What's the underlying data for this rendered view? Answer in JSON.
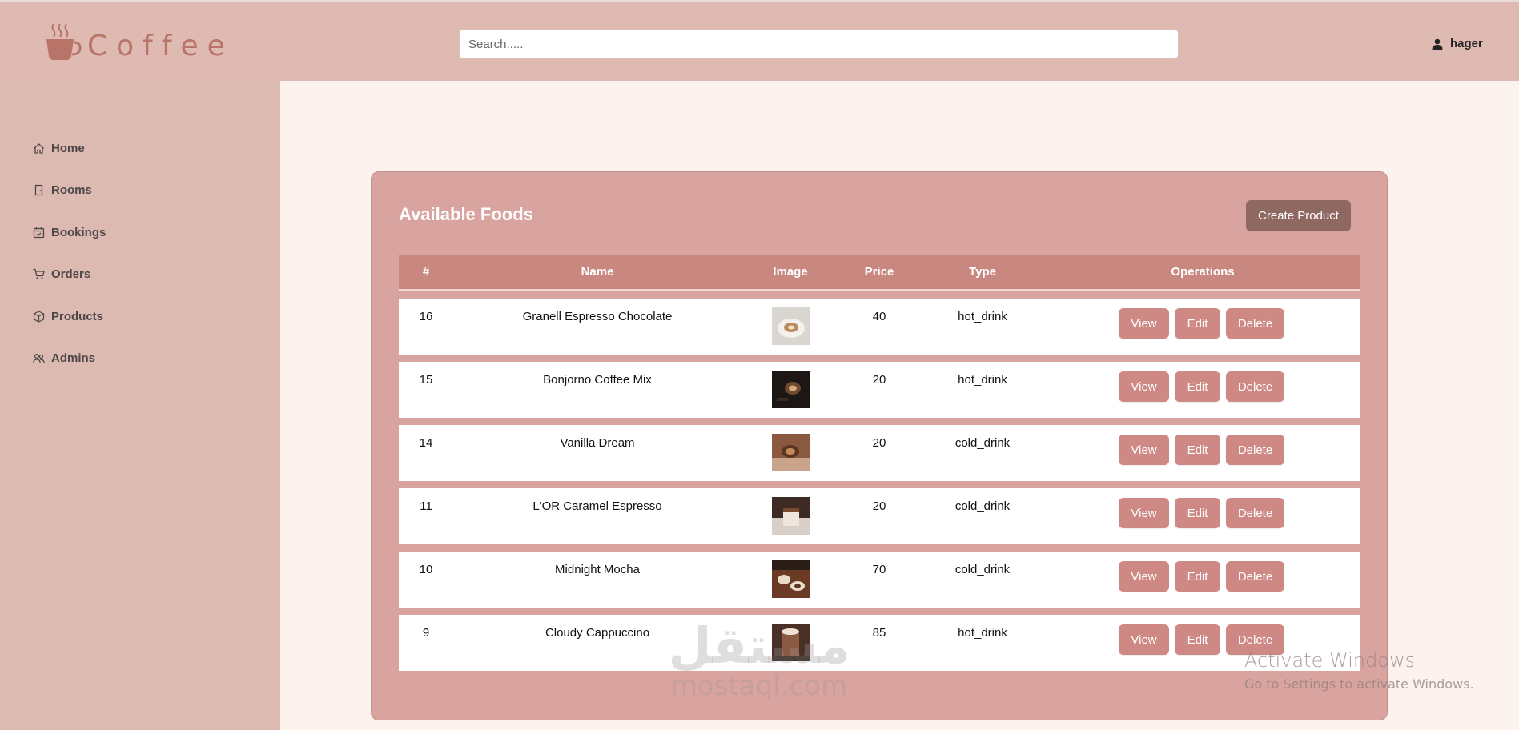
{
  "brand": {
    "name": "Coffee",
    "icon": "coffee-cup-icon",
    "color": "#b87468"
  },
  "search": {
    "placeholder": "Search....."
  },
  "user": {
    "name": "hager",
    "icon": "user-icon"
  },
  "sidebar": {
    "items": [
      {
        "label": "Home",
        "icon": "home-icon"
      },
      {
        "label": "Rooms",
        "icon": "door-icon"
      },
      {
        "label": "Bookings",
        "icon": "calendar-check-icon"
      },
      {
        "label": "Orders",
        "icon": "cart-icon"
      },
      {
        "label": "Products",
        "icon": "box-icon"
      },
      {
        "label": "Admins",
        "icon": "users-icon"
      }
    ]
  },
  "panel": {
    "title": "Available Foods",
    "create_label": "Create Product",
    "columns": [
      "#",
      "Name",
      "Image",
      "Price",
      "Type",
      "Operations"
    ],
    "action_labels": {
      "view": "View",
      "edit": "Edit",
      "delete": "Delete"
    },
    "rows": [
      {
        "id": "16",
        "name": "Granell Espresso Chocolate",
        "price": "40",
        "type": "hot_drink",
        "image": "latte-art-cup-photo"
      },
      {
        "id": "15",
        "name": "Bonjorno Coffee Mix",
        "price": "20",
        "type": "hot_drink",
        "image": "espresso-dark-photo"
      },
      {
        "id": "14",
        "name": "Vanilla Dream",
        "price": "20",
        "type": "cold_drink",
        "image": "coffee-wood-photo"
      },
      {
        "id": "11",
        "name": "L'OR Caramel Espresso",
        "price": "20",
        "type": "cold_drink",
        "image": "caramel-dessert-photo"
      },
      {
        "id": "10",
        "name": "Midnight Mocha",
        "price": "70",
        "type": "cold_drink",
        "image": "mocha-table-photo"
      },
      {
        "id": "9",
        "name": "Cloudy Cappuccino",
        "price": "85",
        "type": "hot_drink",
        "image": "cappuccino-photo"
      }
    ]
  },
  "overlay": {
    "watermark_ar": "مستقل",
    "watermark_en": "mostaql.com",
    "activate_title": "Activate Windows",
    "activate_sub": "Go to Settings to activate Windows."
  },
  "colors": {
    "topbar": "#dfbab2",
    "sidebar": "#dcb9b1",
    "content": "#fdf3ee",
    "panel": "#d9a49f",
    "table_header": "#c88880",
    "action_button": "#cf8985",
    "create_button": "#8f6862"
  }
}
